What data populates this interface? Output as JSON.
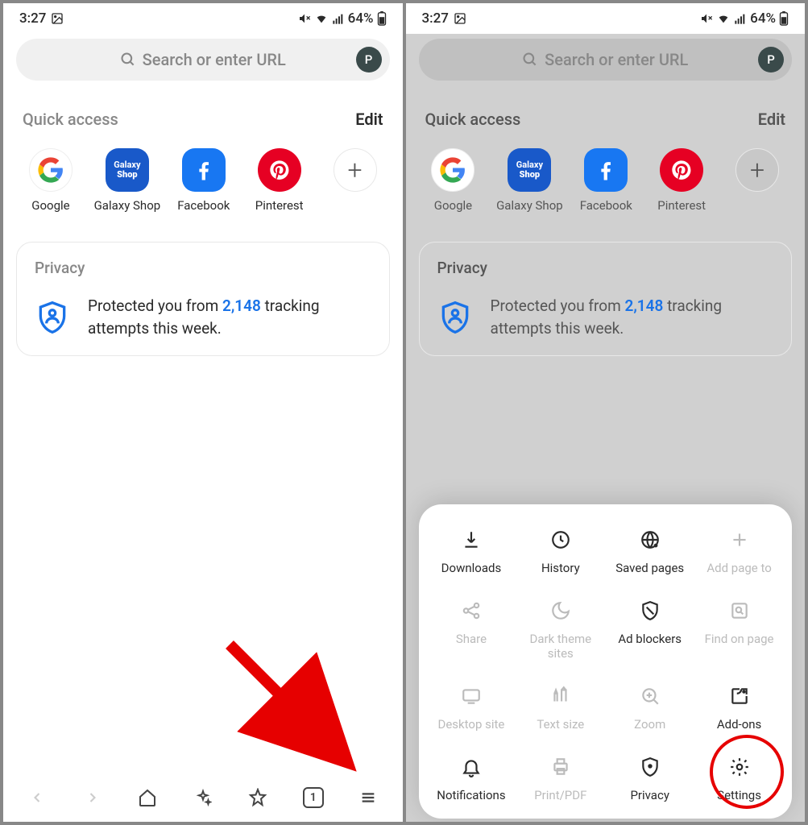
{
  "status": {
    "time": "3:27",
    "battery": "64%"
  },
  "search": {
    "placeholder": "Search or enter URL",
    "avatar_initial": "P"
  },
  "quick_access": {
    "title": "Quick access",
    "edit": "Edit",
    "items": [
      {
        "label": "Google"
      },
      {
        "label": "Galaxy Shop"
      },
      {
        "label": "Facebook"
      },
      {
        "label": "Pinterest"
      }
    ]
  },
  "privacy": {
    "title": "Privacy",
    "text_before": "Protected you from ",
    "count": "2,148",
    "text_after": " tracking attempts this week."
  },
  "bottom_nav": {
    "tab_count": "1"
  },
  "menu": {
    "items": [
      {
        "label": "Downloads",
        "enabled": true
      },
      {
        "label": "History",
        "enabled": true
      },
      {
        "label": "Saved pages",
        "enabled": true
      },
      {
        "label": "Add page to",
        "enabled": false
      },
      {
        "label": "Share",
        "enabled": false
      },
      {
        "label": "Dark theme sites",
        "enabled": false
      },
      {
        "label": "Ad blockers",
        "enabled": true
      },
      {
        "label": "Find on page",
        "enabled": false
      },
      {
        "label": "Desktop site",
        "enabled": false
      },
      {
        "label": "Text size",
        "enabled": false
      },
      {
        "label": "Zoom",
        "enabled": false
      },
      {
        "label": "Add-ons",
        "enabled": true
      },
      {
        "label": "Notifications",
        "enabled": true
      },
      {
        "label": "Print/PDF",
        "enabled": false
      },
      {
        "label": "Privacy",
        "enabled": true
      },
      {
        "label": "Settings",
        "enabled": true
      }
    ]
  }
}
